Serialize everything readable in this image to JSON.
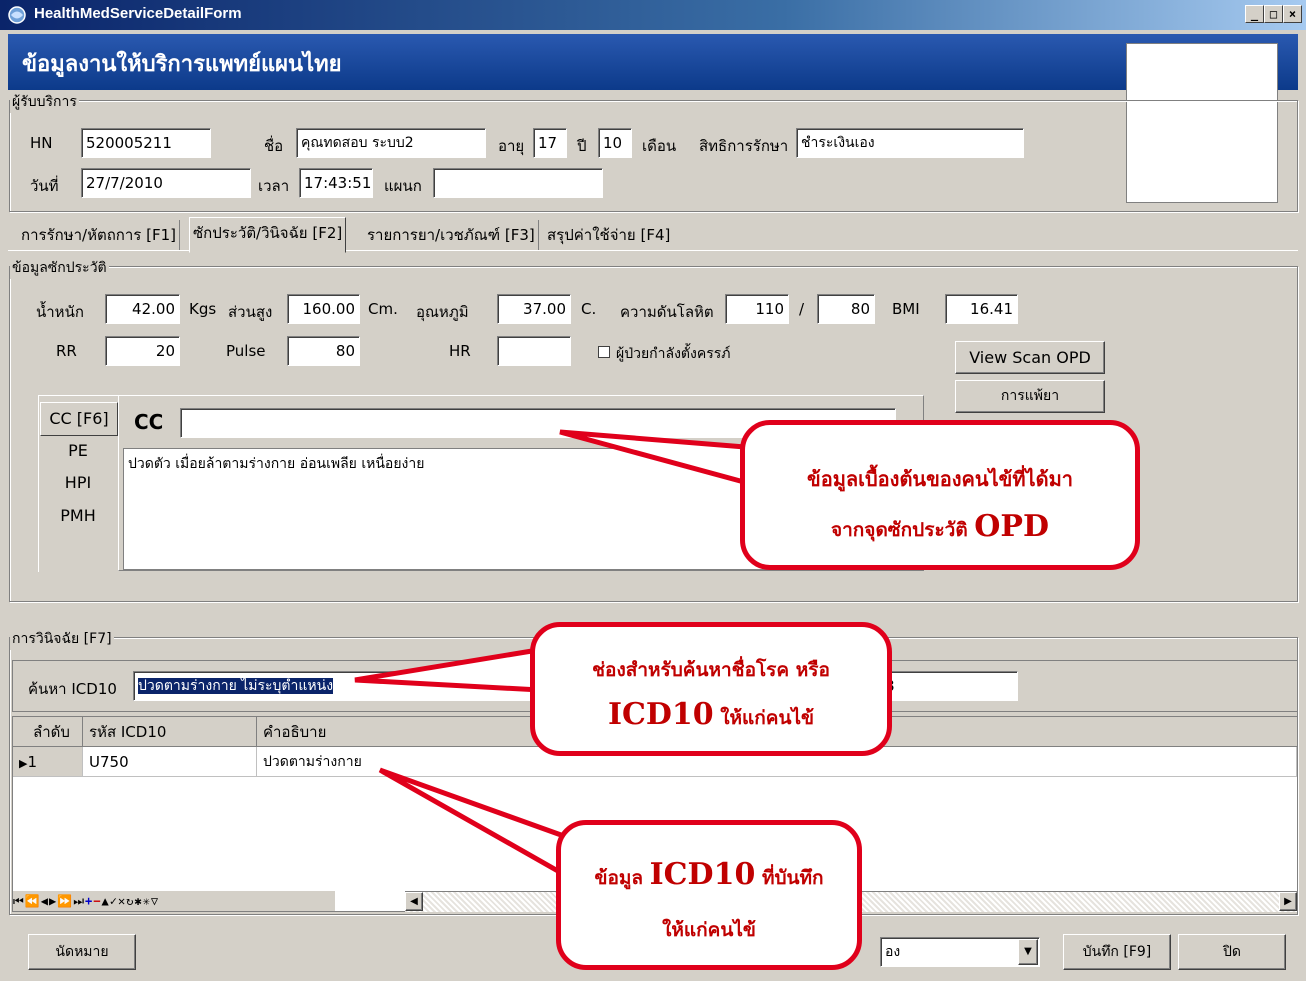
{
  "window": {
    "title": "HealthMedServiceDetailForm"
  },
  "header": {
    "title": "ข้อมูลงานให้บริการแพทย์แผนไทย"
  },
  "patient": {
    "group_label": "ผู้รับบริการ",
    "hn_label": "HN",
    "hn": "520005211",
    "name_label": "ชื่อ",
    "name": "คุณทดสอบ ระบบ2",
    "age_label": "อายุ",
    "age_years": "17",
    "years_label": "ปี",
    "age_months": "10",
    "months_label": "เดือน",
    "right_label": "สิทธิการรักษา",
    "right": "ชำระเงินเอง",
    "date_label": "วันที่",
    "date": "27/7/2010",
    "time_label": "เวลา",
    "time": "17:43:51",
    "dept_label": "แผนก",
    "dept": ""
  },
  "tabs": [
    "การรักษา/หัตถการ [F1]",
    "ซักประวัติ/วินิจฉัย [F2]",
    "รายการยา/เวชภัณฑ์ [F3]",
    "สรุปค่าใช้จ่าย [F4]"
  ],
  "vitals": {
    "group_label": "ข้อมูลซักประวัติ",
    "weight_label": "น้ำหนัก",
    "weight": "42.00",
    "kgs_label": "Kgs",
    "height_label": "ส่วนสูง",
    "height": "160.00",
    "cm_label": "Cm.",
    "temp_label": "อุณหภูมิ",
    "temp": "37.00",
    "c_label": "C.",
    "bp_label": "ความดันโลหิต",
    "bp_sys": "110",
    "bp_sep": "/",
    "bp_dia": "80",
    "bmi_label": "BMI",
    "bmi": "16.41",
    "rr_label": "RR",
    "rr": "20",
    "pulse_label": "Pulse",
    "pulse": "80",
    "hr_label": "HR",
    "hr": "",
    "pregnant_label": "ผู้ป่วยกำลังตั้งครรภ์"
  },
  "side_buttons": {
    "scan": "View Scan OPD",
    "drug_allergy": "การแพ้ยา"
  },
  "history_tabs": [
    "CC [F6]",
    "PE",
    "HPI",
    "PMH"
  ],
  "cc": {
    "label": "CC",
    "input": "",
    "text": "ปวดตัว เมื่อยล้าตามร่างกาย อ่อนเพลีย เหนื่อยง่าย"
  },
  "diagnosis": {
    "group_label": "การวินิจฉัย [F7]",
    "search_label": "ค้นหา ICD10",
    "search_value": "ปวดตามร่างกาย  ไม่ระบุตำแหน่ง",
    "second_value": "8",
    "columns": [
      "ลำดับ",
      "รหัส ICD10",
      "คำอธิบาย"
    ],
    "rows": [
      {
        "no": "1",
        "code": "U750",
        "desc": "ปวดตามร่างกาย"
      }
    ]
  },
  "callouts": {
    "c1_line1": "ข้อมูลเบื้องต้นของคนไข้ที่ได้มา",
    "c1_line2a": "จากจุดซักประวัติ ",
    "c1_line2b": "OPD",
    "c2_line1": "ช่องสำหรับค้นหาชื่อโรค หรือ",
    "c2_line2a": "ICD10",
    "c2_line2b": " ให้แก่คนไข้",
    "c3_line1a": "ข้อมูล ",
    "c3_line1b": "ICD10",
    "c3_line1c": " ที่บันทึก",
    "c3_line2": "ให้แก่คนไข้"
  },
  "footer": {
    "appointment": "นัดหมาย",
    "combo_value": "อง",
    "save": "บันทึก [F9]",
    "close": "ปิด"
  }
}
